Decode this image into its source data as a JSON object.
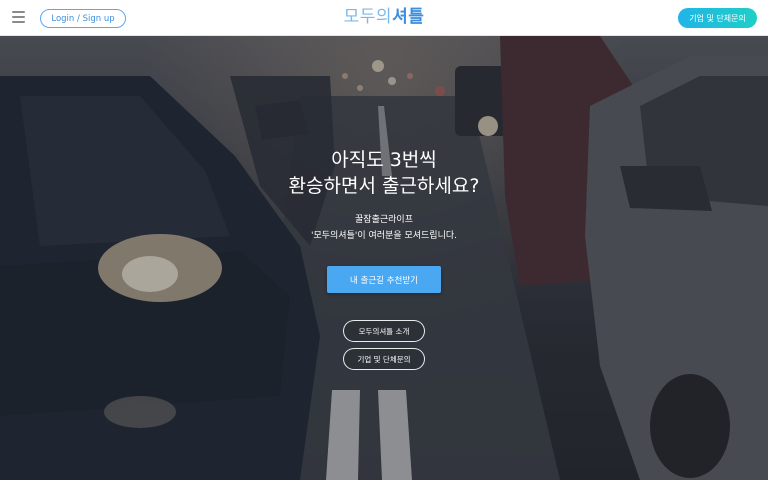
{
  "header": {
    "login_label": "Login / Sign up",
    "logo_part1": "모두의",
    "logo_part2": "셔틀",
    "inquiry_label": "기업 및 단체문의"
  },
  "hero": {
    "headline_line1": "아직도 3번씩",
    "headline_line2": "환승하면서 출근하세요?",
    "sub_line1": "꿀잠출근라이프",
    "sub_line2": "'모두의셔틀'이 여러분을 모셔드립니다.",
    "primary_button": "내 출근길 추천받기",
    "about_button": "모두의셔틀 소개",
    "inquiry_button": "기업 및 단체문의"
  },
  "colors": {
    "accent_blue": "#4aa7f2",
    "inquiry_gradient_start": "#20b5e6",
    "inquiry_gradient_end": "#1ecfc7"
  }
}
